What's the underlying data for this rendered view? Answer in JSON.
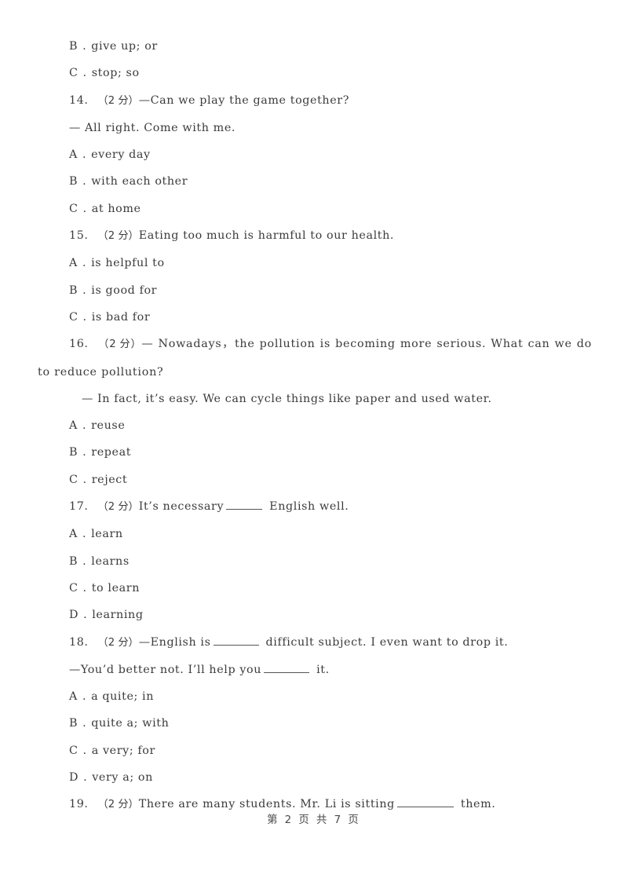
{
  "document": {
    "type": "exam-worksheet",
    "language": "en-zh",
    "background_color": "#ffffff",
    "text_color": "#3b3b3b"
  },
  "carryover_options": [
    {
      "letter": "B",
      "sep": ".",
      "text": "give up; or"
    },
    {
      "letter": "C",
      "sep": ".",
      "text": "stop; so"
    }
  ],
  "questions": [
    {
      "number": "14.",
      "points": "（2 分）",
      "stem": "—Can we play the game together?",
      "dialogue": "— All right. Come with me.",
      "options": [
        {
          "letter": "A",
          "sep": ".",
          "text": "every day"
        },
        {
          "letter": "B",
          "sep": ".",
          "text": "with each other"
        },
        {
          "letter": "C",
          "sep": ".",
          "text": "at home"
        }
      ]
    },
    {
      "number": "15.",
      "points": "（2 分）",
      "stem": "Eating too much is harmful to our health.",
      "options": [
        {
          "letter": "A",
          "sep": ".",
          "text": "is helpful to"
        },
        {
          "letter": "B",
          "sep": ".",
          "text": "is good for"
        },
        {
          "letter": "C",
          "sep": ".",
          "text": "is bad for"
        }
      ]
    },
    {
      "number": "16.",
      "points": "（2 分）",
      "stem": "— Nowadays，the pollution is becoming more serious. What can we do to reduce pollution?",
      "dialogue": "— In fact, it’s easy. We can cycle things like paper and used water.",
      "options": [
        {
          "letter": "A",
          "sep": ".",
          "text": "reuse"
        },
        {
          "letter": "B",
          "sep": ".",
          "text": "repeat"
        },
        {
          "letter": "C",
          "sep": ".",
          "text": "reject"
        }
      ]
    },
    {
      "number": "17.",
      "points": "（2 分）",
      "stem_before": "It’s necessary",
      "stem_after": "English well.",
      "options": [
        {
          "letter": "A",
          "sep": ".",
          "text": "learn"
        },
        {
          "letter": "B",
          "sep": ".",
          "text": "learns"
        },
        {
          "letter": "C",
          "sep": ".",
          "text": "to learn"
        },
        {
          "letter": "D",
          "sep": ".",
          "text": "learning"
        }
      ]
    },
    {
      "number": "18.",
      "points": "（2 分）",
      "stem_before": "—English is",
      "stem_after": "difficult subject. I even want to drop it.",
      "dialogue_before": "—You’d better not. I’ll help you",
      "dialogue_after": "it.",
      "options": [
        {
          "letter": "A",
          "sep": ".",
          "text": "a quite; in"
        },
        {
          "letter": "B",
          "sep": ".",
          "text": "quite a; with"
        },
        {
          "letter": "C",
          "sep": ".",
          "text": "a very; for"
        },
        {
          "letter": "D",
          "sep": ".",
          "text": "very a; on"
        }
      ]
    },
    {
      "number": "19.",
      "points": "（2 分）",
      "stem_before": "There are many students. Mr. Li is sitting",
      "stem_after": "them."
    }
  ],
  "footer": {
    "prefix": "第",
    "current_page": "2",
    "page_unit_1": "页",
    "total_label": "共",
    "total_pages": "7",
    "page_unit_2": "页",
    "full_text": "第 2 页 共 7 页"
  }
}
